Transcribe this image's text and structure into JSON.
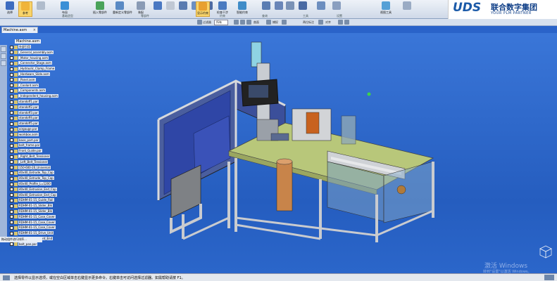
{
  "ribbon": {
    "buttons": [
      {
        "label": "选择",
        "active": false
      },
      {
        "label": "参考",
        "active": true
      },
      {
        "label": "",
        "active": false
      },
      {
        "label": "布局",
        "active": false
      },
      {
        "label": "插入零部件",
        "active": false
      },
      {
        "label": "重新定义零部件",
        "active": false
      },
      {
        "label": "装配",
        "active": false
      },
      {
        "label": "",
        "active": false
      },
      {
        "label": "",
        "active": false
      },
      {
        "label": "",
        "active": false
      },
      {
        "label": "",
        "active": false
      },
      {
        "label": "",
        "active": false
      },
      {
        "label": "显示约束",
        "active": true
      },
      {
        "label": "检查干涉",
        "active": false
      },
      {
        "label": "智能约束",
        "active": false
      },
      {
        "label": "",
        "active": false
      },
      {
        "label": "",
        "active": false
      },
      {
        "label": "",
        "active": false
      },
      {
        "label": "",
        "active": false
      },
      {
        "label": "",
        "active": false
      },
      {
        "label": "",
        "active": false
      },
      {
        "label": "视图工具",
        "active": false
      },
      {
        "label": "",
        "active": false
      }
    ],
    "groups": [
      "基础造型",
      "零部件",
      "约束",
      "查询",
      "工具",
      "设置"
    ]
  },
  "logo": {
    "mark": "UDS",
    "cn": "联合数字集团",
    "en": "YOUR PLM PARTNER"
  },
  "quickbar": {
    "items": [
      "过滤器",
      "所有",
      "",
      "",
      "",
      "",
      "曲面",
      "",
      "捕捉",
      "",
      "",
      "两位标注",
      "",
      "对齐"
    ]
  },
  "document_tab": {
    "label": "Machine.asm"
  },
  "tree": {
    "header": "Machine.asm",
    "rows": [
      "外部引用",
      "_General_assembly.asm",
      "_Motor_housing.asm",
      "_Connector_Stage.asm",
      "_Hydraulic_Clamp_Frame",
      "_Hardware_Slide.asm",
      "_Panel.asm",
      "_Coolant.asm",
      "_Components.asm",
      "_Independent_housing.asm",
      "standoff1.par",
      "standoff2.par",
      "standoff3.par",
      "standoff4.par",
      "standoff5.par",
      "airgauge.par",
      "workbox.asm",
      "base_part.par",
      "bolt_frame.par",
      "Front_Guide.par",
      "_Right_Belt_Tensioner",
      "_Left_Belt_Tensioner",
      "150-600-20_Universal",
      "40x40_Extrude_Top_Cap",
      "40x40_Extrude_Top_Cap",
      "40x40_Profile_L=1200",
      "40x40_Extrusion_End_Cap",
      "40x40_Extrusion_End_Cap",
      "RDHM-01-15_Guide_Rail",
      "RDHM-01-15_Slider_Blk",
      "RDHM-01-15_Slider_Blk",
      "RDHM-01-15_Case_Cover",
      "RDHM-01-15_Case_Cover",
      "RDHM-01-15_Case_Cover",
      "RDHM-01-15_Drive_Unit",
      "RDHM-01-15_Front_End",
      "bolt_pan.par"
    ]
  },
  "bottom_strip": "拖动组件进行排序…",
  "status": {
    "message": "选择零件以显示选项，或在空白区域单击右键显示更多命令。右键单击可访问选择过滤器。如需帮助请按 F1。"
  },
  "watermark": {
    "line1": "激活 Windows",
    "line2": "转到\"设置\"以激活 Windows。"
  }
}
